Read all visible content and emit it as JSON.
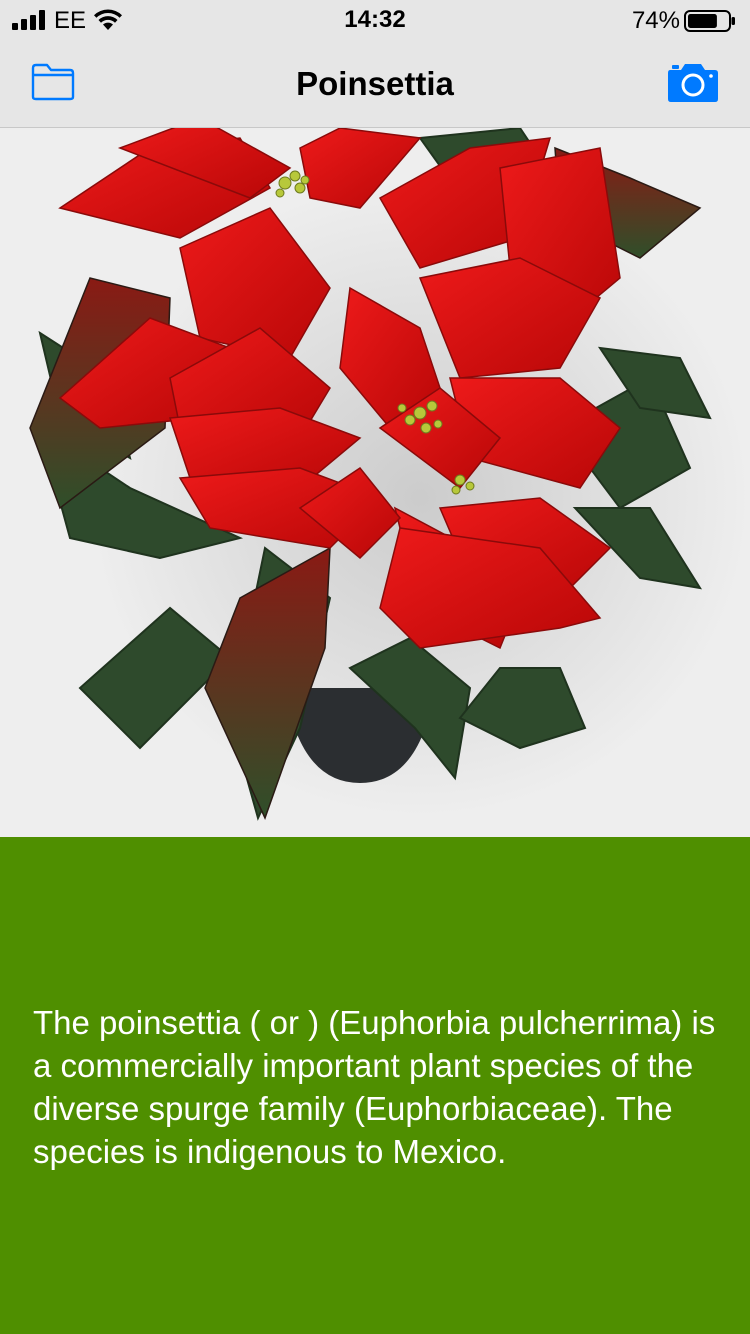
{
  "status_bar": {
    "carrier": "EE",
    "time": "14:32",
    "battery_percent": "74%",
    "battery_level": 0.74,
    "signal_icon": "signal-bars-icon",
    "wifi_icon": "wifi-icon",
    "battery_icon": "battery-icon"
  },
  "nav": {
    "title": "Poinsettia",
    "left_icon": "folder-icon",
    "right_icon": "camera-icon",
    "accent_color": "#007aff"
  },
  "photo": {
    "subject": "poinsettia-plant-photo",
    "background_color": "#eeeeee"
  },
  "info": {
    "background_color": "#4f8f00",
    "text_color": "#ffffff",
    "description": "The poinsettia ( or ) (Euphorbia pulcherrima) is a commercially important plant species of the diverse spurge family (Euphorbiaceae). The species is indigenous to Mexico."
  }
}
